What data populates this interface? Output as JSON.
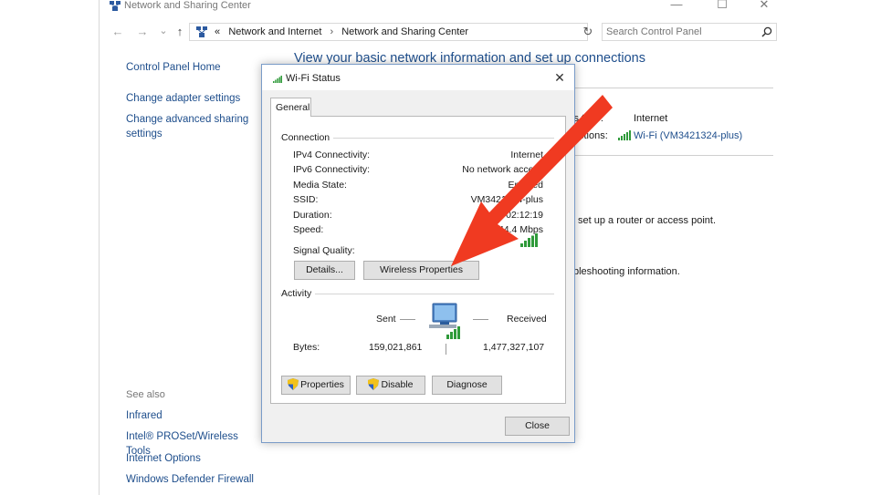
{
  "window": {
    "title": "Network and Sharing Center",
    "controls": {
      "minimize": "—",
      "maximize": "☐",
      "close": "✕"
    }
  },
  "address_bar": {
    "back": "←",
    "forward": "→",
    "recent": "⌄",
    "up": "↑",
    "overflow": "«",
    "breadcrumbs": [
      "Network and Internet",
      "Network and Sharing Center"
    ],
    "separator": "›",
    "dropdown": "⌄",
    "refresh": "↻",
    "search_placeholder": "Search Control Panel"
  },
  "left_pane": {
    "home": "Control Panel Home",
    "links": [
      "Change adapter settings",
      "Change advanced sharing",
      "settings"
    ],
    "see_also_label": "See also",
    "see_also": [
      "Infrared",
      "Intel® PROSet/Wireless Tools",
      "Internet Options",
      "Windows Defender Firewall"
    ]
  },
  "main": {
    "title": "View your basic network information and set up connections",
    "access_type_partial": "ss type:",
    "access_type_value": "Internet",
    "connections_partial": "ctions:",
    "connections_value": "Wi-Fi (VM3421324-plus)",
    "setup_partial": "set up a router or access point.",
    "troubleshoot_partial": "bleshooting information."
  },
  "dialog": {
    "title": "Wi-Fi Status",
    "close": "✕",
    "tab": "General",
    "connection_group": "Connection",
    "rows": [
      {
        "label": "IPv4 Connectivity:",
        "value": "Internet"
      },
      {
        "label": "IPv6 Connectivity:",
        "value": "No network access"
      },
      {
        "label": "Media State:",
        "value": "Enabled"
      },
      {
        "label": "SSID:",
        "value": "VM3421324-plus"
      },
      {
        "label": "Duration:",
        "value": "1 day 02:12:19"
      },
      {
        "label": "Speed:",
        "value": "144.4 Mbps"
      }
    ],
    "signal_quality_label": "Signal Quality:",
    "details_button": "Details...",
    "wireless_properties_button": "Wireless Properties",
    "activity_group": "Activity",
    "sent_label": "Sent",
    "received_label": "Received",
    "bytes_label": "Bytes:",
    "bytes_sent": "159,021,861",
    "bytes_received": "1,477,327,107",
    "properties_button": "Properties",
    "disable_button": "Disable",
    "diagnose_button": "Diagnose",
    "close_button": "Close"
  },
  "colors": {
    "link": "#1e4e8c",
    "arrow": "#f03a21",
    "signal": "#2f9a3a"
  }
}
